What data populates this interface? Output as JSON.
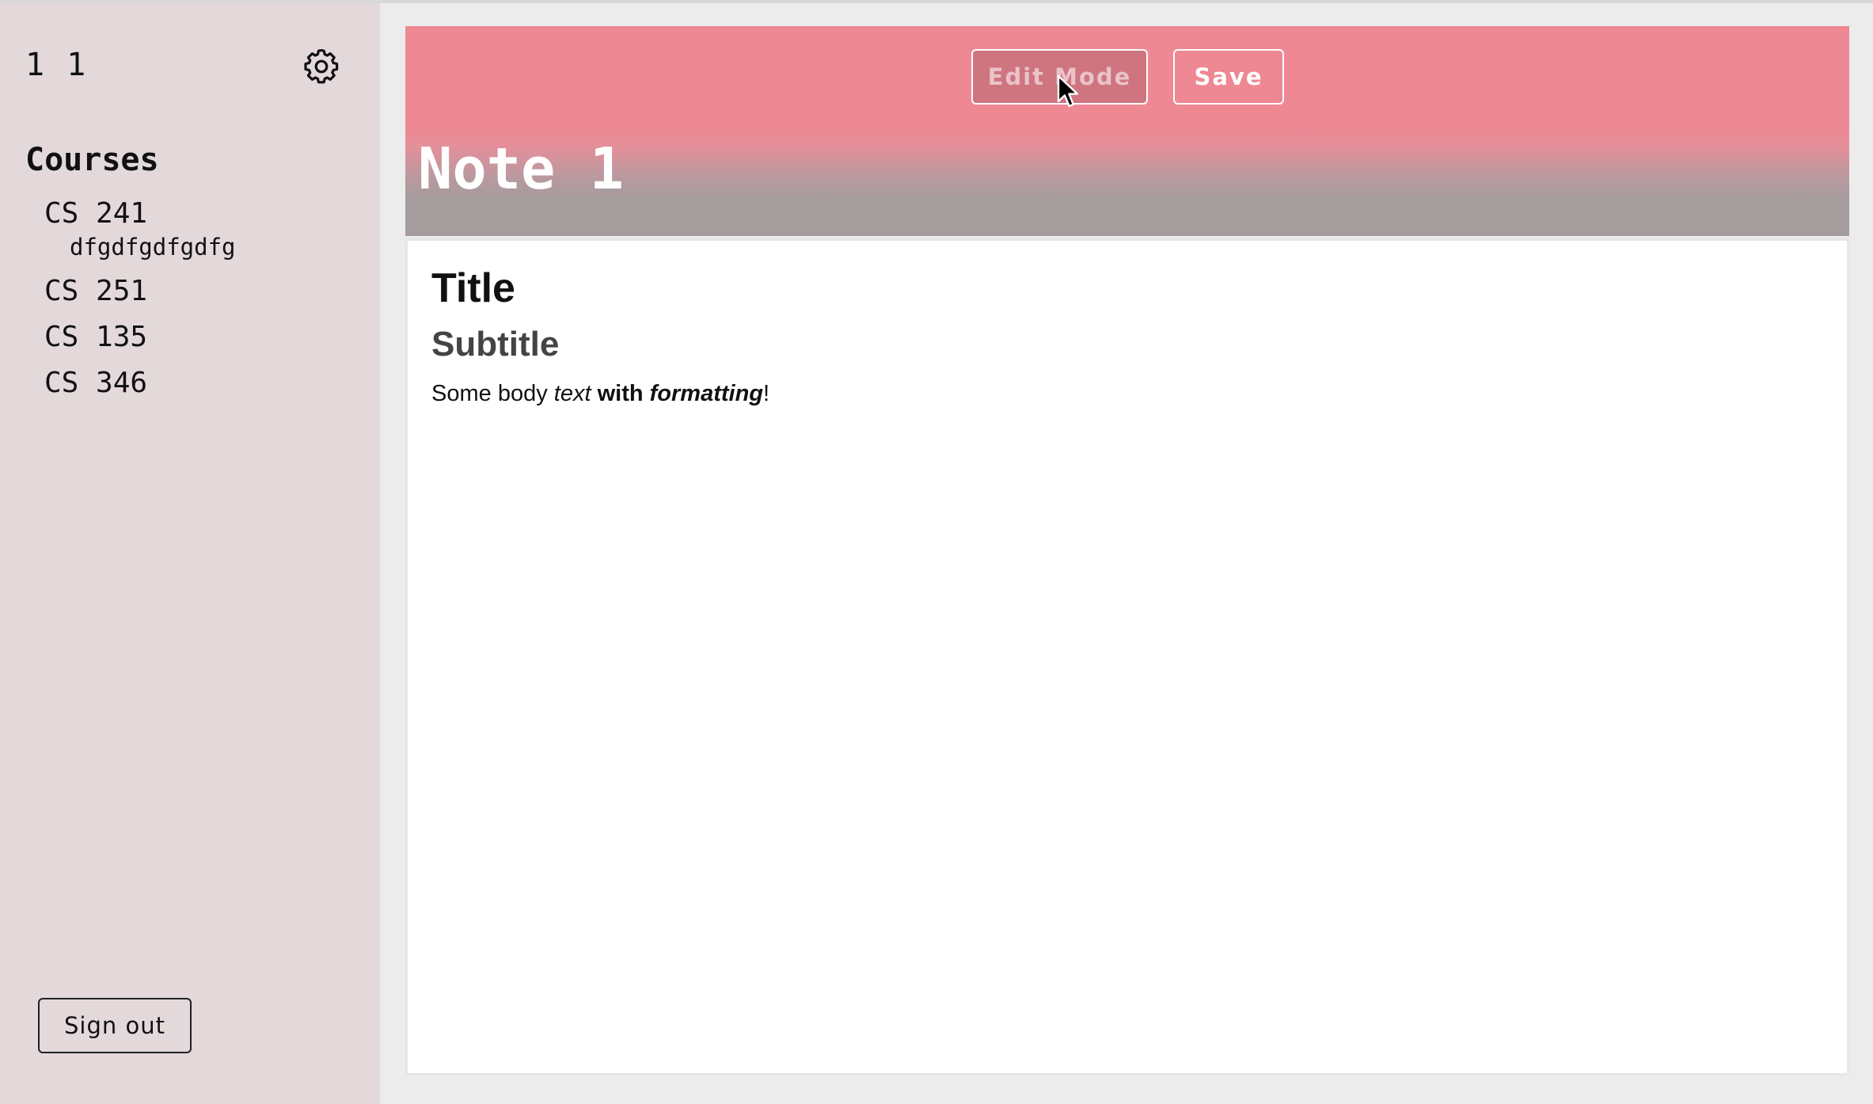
{
  "sidebar": {
    "user_name": "1 1",
    "settings_icon": "gear-icon",
    "courses_heading": "Courses",
    "courses": [
      {
        "label": "CS 241",
        "notes": [
          "dfgdfgdfgdfg"
        ]
      },
      {
        "label": "CS 251",
        "notes": []
      },
      {
        "label": "CS 135",
        "notes": []
      },
      {
        "label": "CS 346",
        "notes": []
      }
    ],
    "sign_out_label": "Sign out"
  },
  "header": {
    "edit_mode_label": "Edit Mode",
    "save_label": "Save",
    "note_title": "Note 1"
  },
  "editor": {
    "title": "Title",
    "subtitle": "Subtitle",
    "body": {
      "plain_1": "Some body ",
      "italic": "text",
      "plain_2": " ",
      "bold": "with ",
      "bold_italic": "formatting",
      "plain_3": "!"
    }
  },
  "colors": {
    "sidebar_bg": "#e3d9da",
    "header_pink": "#ee8893",
    "header_gray": "#a59c9e",
    "edit_button_bg": "#cf7580"
  }
}
